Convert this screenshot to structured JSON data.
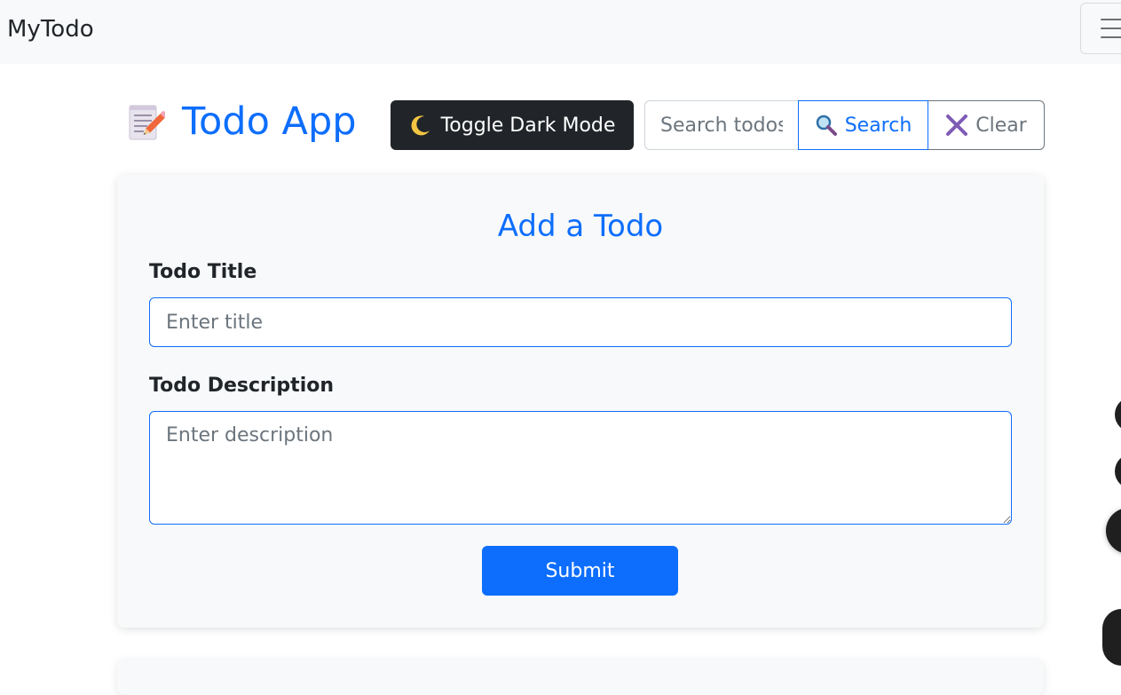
{
  "navbar": {
    "brand": "MyTodo"
  },
  "header": {
    "title": "Todo App",
    "app_icon": "memo-pencil-icon",
    "dark_mode_button": "Toggle Dark Mode",
    "moon_icon": "crescent-moon-icon"
  },
  "search": {
    "placeholder": "Search todos",
    "search_button": "Search",
    "clear_button": "Clear",
    "search_icon": "magnifier-icon",
    "clear_icon": "cross-mark-icon"
  },
  "form": {
    "heading": "Add a Todo",
    "title_label": "Todo Title",
    "title_placeholder": "Enter title",
    "description_label": "Todo Description",
    "description_placeholder": "Enter description",
    "submit_button": "Submit"
  },
  "colors": {
    "primary": "#0d6efd",
    "dark": "#212529",
    "secondary": "#6c757d",
    "navbar_bg": "#f8f9fa",
    "card_bg": "#f8f9fa"
  }
}
